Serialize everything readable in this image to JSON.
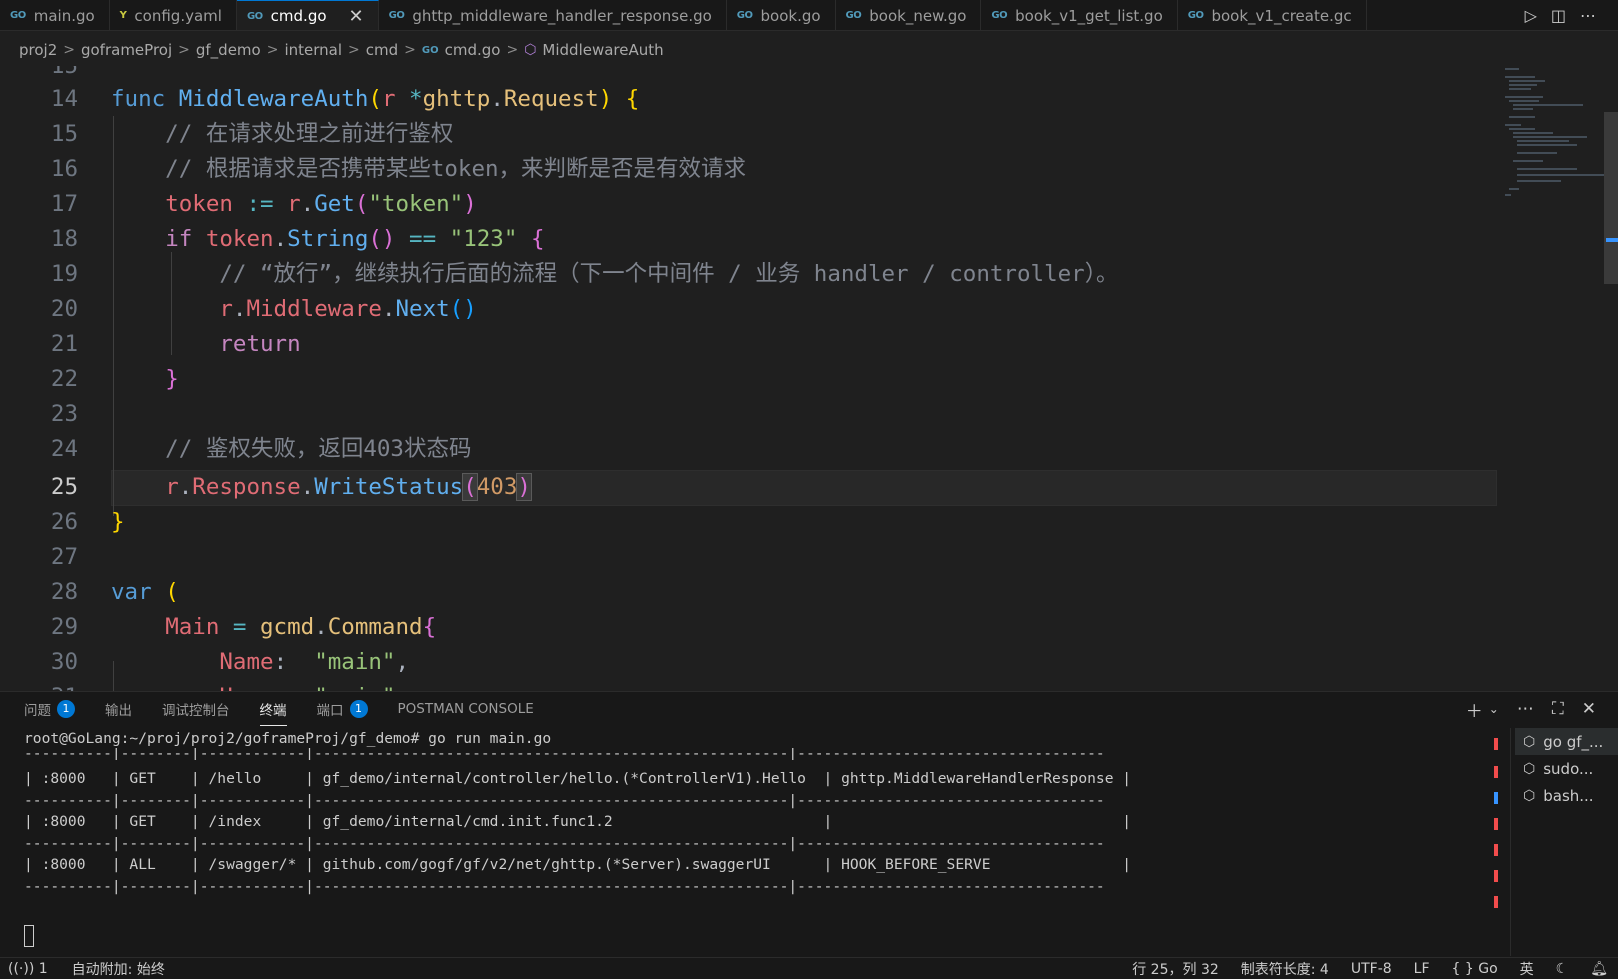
{
  "tabs": [
    {
      "label": "main.go",
      "icon": "go-icon"
    },
    {
      "label": "config.yaml",
      "icon": "yaml-icon"
    },
    {
      "label": "cmd.go",
      "icon": "go-icon",
      "active": true
    },
    {
      "label": "ghttp_middleware_handler_response.go",
      "icon": "go-icon"
    },
    {
      "label": "book.go",
      "icon": "go-icon"
    },
    {
      "label": "book_new.go",
      "icon": "go-icon"
    },
    {
      "label": "book_v1_get_list.go",
      "icon": "go-icon"
    },
    {
      "label": "book_v1_create.gc",
      "icon": "go-icon"
    }
  ],
  "go_badge": "GO",
  "yaml_badge": "Y",
  "close_glyph": "✕",
  "breadcrumb": [
    "proj2",
    "goframeProj",
    "gf_demo",
    "internal",
    "cmd",
    "cmd.go",
    "MiddlewareAuth"
  ],
  "editor": {
    "current_line": 25,
    "top_partial": "15"
  },
  "panel": {
    "tabs": [
      {
        "label": "问题",
        "badge": "1"
      },
      {
        "label": "输出"
      },
      {
        "label": "调试控制台"
      },
      {
        "label": "终端",
        "active": true
      },
      {
        "label": "端口",
        "badge": "1"
      },
      {
        "label": "POSTMAN CONSOLE"
      }
    ],
    "terminal_lines": [
      "root@GoLang:~/proj/proj2/goframeProj/gf_demo# go run main.go",
      "----------|--------|------------|------------------------------------------------------|-----------------------------------",
      "| :8000   | GET    | /hello     | gf_demo/internal/controller/hello.(*ControllerV1).Hello  | ghttp.MiddlewareHandlerResponse |",
      "----------|--------|------------|------------------------------------------------------|-----------------------------------",
      "| :8000   | GET    | /index     | gf_demo/internal/cmd.init.func1.2                        |                                 |",
      "----------|--------|------------|------------------------------------------------------|-----------------------------------",
      "| :8000   | ALL    | /swagger/* | github.com/gogf/gf/v2/net/ghttp.(*Server).swaggerUI      | HOOK_BEFORE_SERVE               |",
      "----------|--------|------------|------------------------------------------------------|-----------------------------------"
    ],
    "terminal_list": [
      "go gf_...",
      "sudo...",
      "bash..."
    ]
  },
  "statusbar": {
    "left": [
      "1",
      "自动附加: 始终"
    ],
    "right": [
      "行 25，列 32",
      "制表符长度: 4",
      "UTF-8",
      "LF",
      "{ } Go",
      "英"
    ]
  }
}
